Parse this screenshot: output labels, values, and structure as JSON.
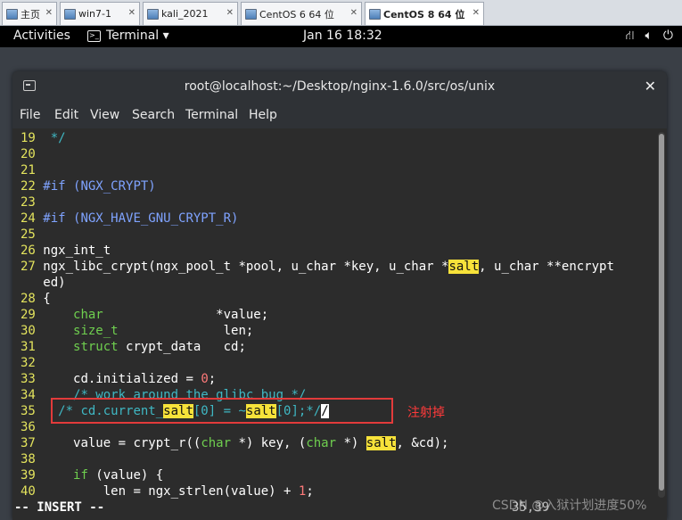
{
  "vm_tabs": [
    {
      "label": "主页",
      "active": false
    },
    {
      "label": "win7-1",
      "active": false
    },
    {
      "label": "kali_2021",
      "active": false
    },
    {
      "label": "CentOS 6 64 位",
      "active": false
    },
    {
      "label": "CentOS 8 64 位",
      "active": true
    }
  ],
  "topbar": {
    "activities": "Activities",
    "app": "Terminal ▾",
    "clock": "Jan 16  18:32",
    "sys_icons": [
      "network-icon",
      "volume-icon",
      "power-icon"
    ]
  },
  "window": {
    "title": "root@localhost:~/Desktop/nginx-1.6.0/src/os/unix",
    "close": "✕"
  },
  "menu": [
    "File",
    "Edit",
    "View",
    "Search",
    "Terminal",
    "Help"
  ],
  "code": {
    "l19": {
      "n": "19",
      "t": " */"
    },
    "l20": {
      "n": "20"
    },
    "l21": {
      "n": "21"
    },
    "l22": {
      "n": "22",
      "a": "#if (NGX_CRYPT)"
    },
    "l23": {
      "n": "23"
    },
    "l24": {
      "n": "24",
      "a": "#if (NGX_HAVE_GNU_CRYPT_R)"
    },
    "l25": {
      "n": "25"
    },
    "l26": {
      "n": "26",
      "a": "ngx_int_t"
    },
    "l27": {
      "n": "27",
      "a": "ngx_libc_crypt(ngx_pool_t *pool, u_char *key, u_char *",
      "h": "salt",
      "b": ", u_char **encrypt"
    },
    "l27b": {
      "a": "ed)"
    },
    "l28": {
      "n": "28",
      "a": "{"
    },
    "l29": {
      "n": "29",
      "k": "char",
      "r": "               *value;"
    },
    "l30": {
      "n": "30",
      "k": "size_t",
      "r": "              len;"
    },
    "l31": {
      "n": "31",
      "k": "struct",
      "r": " crypt_data   cd;"
    },
    "l32": {
      "n": "32"
    },
    "l33": {
      "n": "33",
      "a": "    cd.initialized = ",
      "num": "0",
      "b": ";"
    },
    "l34": {
      "n": "34",
      "c": "    /* work around the glibc bug */"
    },
    "l35": {
      "n": "35",
      "c1": "  /* cd.current_",
      "h1": "salt",
      "c2": "[0] = ~",
      "h2": "salt",
      "c3": "[0];*/",
      "cur": "/"
    },
    "l36": {
      "n": "36"
    },
    "l37": {
      "n": "37",
      "a": "    value = crypt_r((",
      "k1": "char",
      "b": " *) key, (",
      "k2": "char",
      "c": " *) ",
      "h": "salt",
      "d": ", &cd);"
    },
    "l38": {
      "n": "38"
    },
    "l39": {
      "n": "39",
      "k": "if",
      "r": " (value) {"
    },
    "l40": {
      "n": "40",
      "a": "        len = ngx_strlen(value) + ",
      "num": "1",
      "b": ";"
    }
  },
  "status": "-- INSERT --",
  "cursor_pos": "35,39",
  "annotation": "注射掉",
  "watermark": "CSDN @入狱计划进度50%"
}
